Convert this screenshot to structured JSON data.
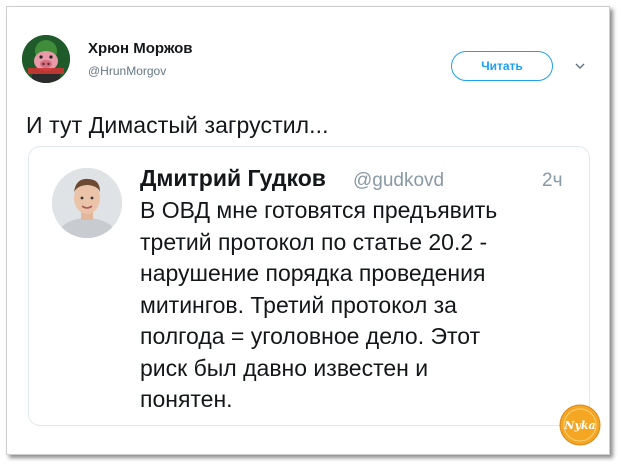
{
  "tweet": {
    "author_name": "Хрюн Моржов",
    "author_handle": "@HrunMorgov",
    "follow_label": "Читать",
    "text": "И тут Димастый загрустил...",
    "quoted": {
      "author_name": "Дмитрий Гудков",
      "author_handle": "@gudkovd",
      "time": "2ч",
      "lines": [
        "В ОВД мне готовятся предъявить",
        "третий протокол по статье 20.2 -",
        "нарушение порядка проведения",
        "митингов. Третий протокол за",
        "полгода = уголовное дело. Этот",
        "риск был давно известен и",
        "понятен."
      ]
    }
  },
  "watermark_text": "Nyka",
  "colors": {
    "accent": "#1da1f2",
    "text": "#14171a",
    "muted": "#657786",
    "watermark": "#f5a623"
  },
  "icons": {
    "menu": "chevron-down-icon"
  }
}
